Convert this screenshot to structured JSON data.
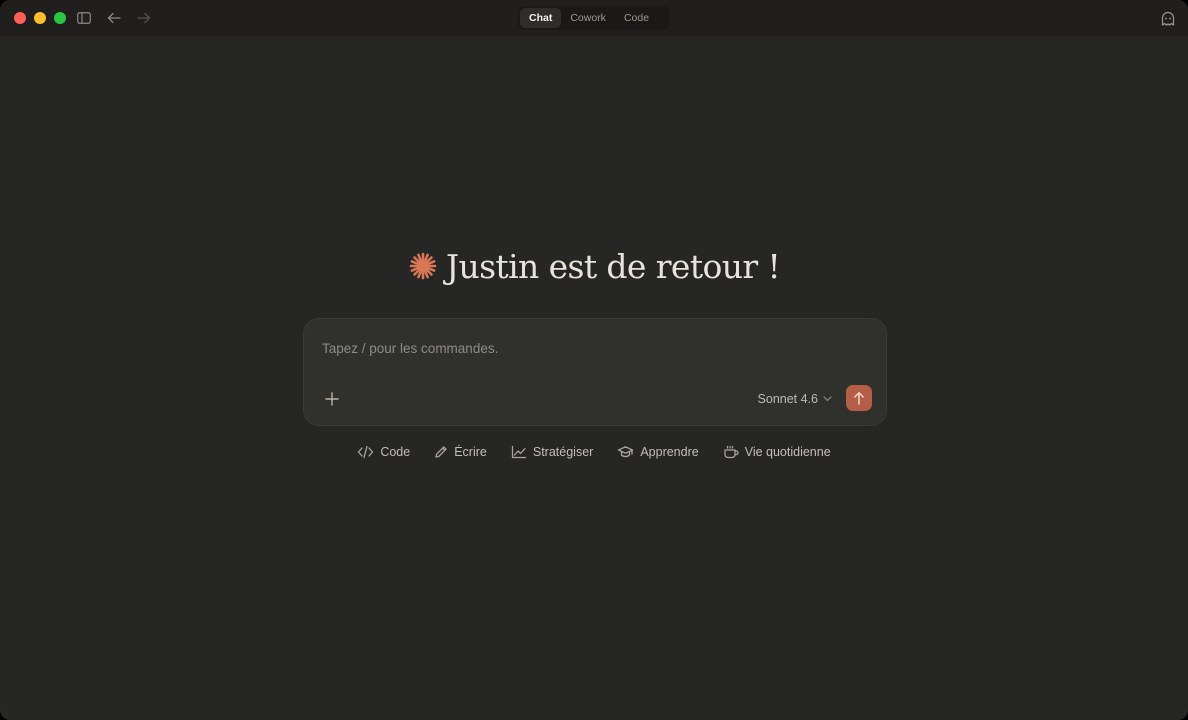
{
  "titlebar": {
    "tabs": [
      {
        "label": "Chat",
        "active": true
      },
      {
        "label": "Cowork",
        "active": false
      },
      {
        "label": "Code",
        "active": false
      }
    ]
  },
  "greeting": {
    "text": "Justin est de retour !",
    "icon": "spark-icon",
    "accent_color": "#d97757"
  },
  "composer": {
    "placeholder": "Tapez / pour les commandes.",
    "value": "",
    "model_label": "Sonnet 4.6",
    "send_color": "#b45e48"
  },
  "suggestions": [
    {
      "label": "Code",
      "icon": "code-icon"
    },
    {
      "label": "Écrire",
      "icon": "pen-icon"
    },
    {
      "label": "Stratégiser",
      "icon": "chart-icon"
    },
    {
      "label": "Apprendre",
      "icon": "graduation-cap-icon"
    },
    {
      "label": "Vie quotidienne",
      "icon": "coffee-cup-icon"
    }
  ]
}
